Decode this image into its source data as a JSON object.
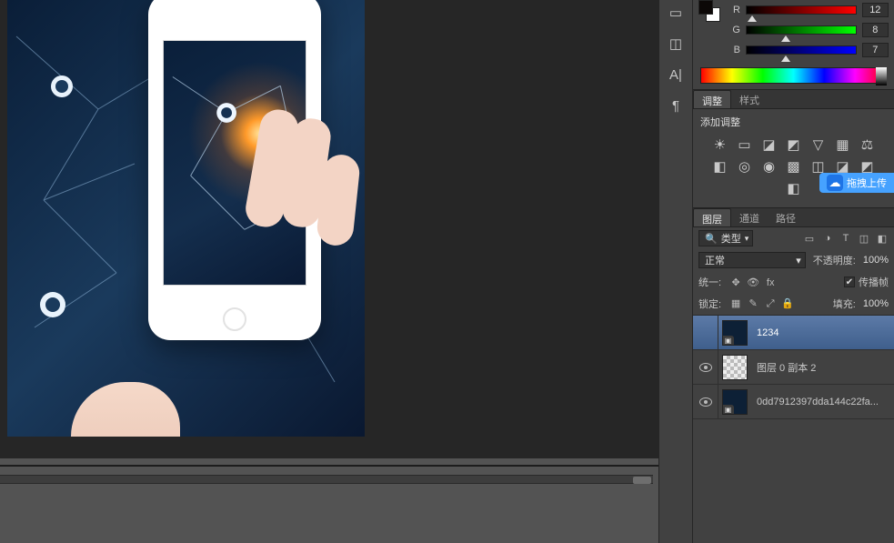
{
  "color": {
    "r_label": "R",
    "r_value": "12",
    "g_label": "G",
    "g_value": "8",
    "b_label": "B",
    "b_value": "7",
    "r_knob_pct": 5,
    "g_knob_pct": 36,
    "b_knob_pct": 36
  },
  "tabs_adjust": {
    "adjust": "调整",
    "style": "样式"
  },
  "adjustments": {
    "add_label": "添加调整",
    "icons": [
      "☀",
      "▭",
      "◪",
      "◩",
      "▽",
      "▦",
      "⚖",
      "◧",
      "◎",
      "◉",
      "▩",
      "◫",
      "◪",
      "◩",
      "◧"
    ]
  },
  "drag_upload": "拖拽上传",
  "tabs_layers": {
    "layers": "图层",
    "channels": "通道",
    "paths": "路径"
  },
  "layer_toolbar": {
    "kind_icon": "🔍",
    "kind_label": "类型",
    "filters": [
      "▭",
      "◑",
      "T",
      "◫",
      "◧"
    ]
  },
  "blend": {
    "mode": "正常",
    "opacity_label": "不透明度:",
    "opacity_value": "100%"
  },
  "unify": {
    "label": "统一:",
    "propagate_label": "传播帧",
    "propagate_checked": true
  },
  "lock": {
    "label": "锁定:",
    "icons": [
      "▦",
      "✎",
      "⤢",
      "🔒"
    ],
    "fill_label": "填充:",
    "fill_value": "100%"
  },
  "layers": [
    {
      "name": "1234",
      "visible": false,
      "thumb": "dark",
      "selected": true
    },
    {
      "name": "图层 0 副本 2",
      "visible": true,
      "thumb": "trans",
      "selected": false
    },
    {
      "name": "0dd7912397dda144c22fa...",
      "visible": true,
      "thumb": "dark",
      "selected": false
    }
  ],
  "tool_col_icons": [
    "▭",
    "◫",
    "A|",
    "¶"
  ]
}
